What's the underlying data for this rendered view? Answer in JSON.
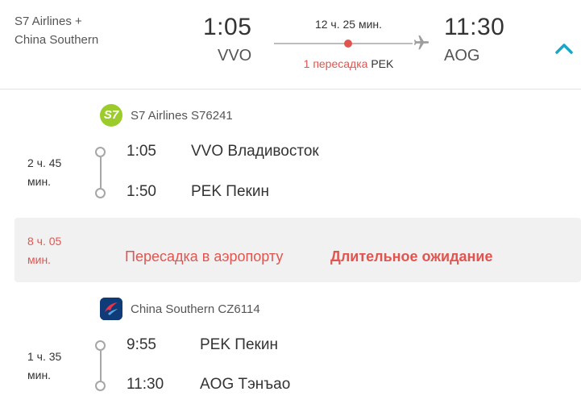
{
  "header": {
    "airlines": "S7 Airlines + China Southern",
    "departure": {
      "time": "1:05",
      "code": "VVO"
    },
    "arrival": {
      "time": "11:30",
      "code": "AOG"
    },
    "duration": "12 ч. 25 мин.",
    "stops_label": "1 пересадка",
    "stops_airport": "PEK",
    "collapse_icon": "chevron-up-icon"
  },
  "segments": [
    {
      "airline": "S7 Airlines S76241",
      "logo_text": "S7",
      "duration": "2 ч. 45 мин.",
      "from_time": "1:05",
      "from_airport": "VVO Владивосток",
      "to_time": "1:50",
      "to_airport": "PEK Пекин"
    },
    {
      "airline": "China Southern CZ6114",
      "duration": "1 ч. 35 мин.",
      "from_time": "9:55",
      "from_airport": "PEK Пекин",
      "to_time": "11:30",
      "to_airport": "AOG Тэнъао"
    }
  ],
  "layover": {
    "duration": "8 ч. 05 мин.",
    "text": "Пересадка в аэропорту",
    "warning": "Длительное ожидание"
  },
  "colors": {
    "accent": "#e05550",
    "chevron": "#1aa6c7",
    "s7_green": "#9ccc2c",
    "china_southern_blue": "#0f3b78"
  }
}
